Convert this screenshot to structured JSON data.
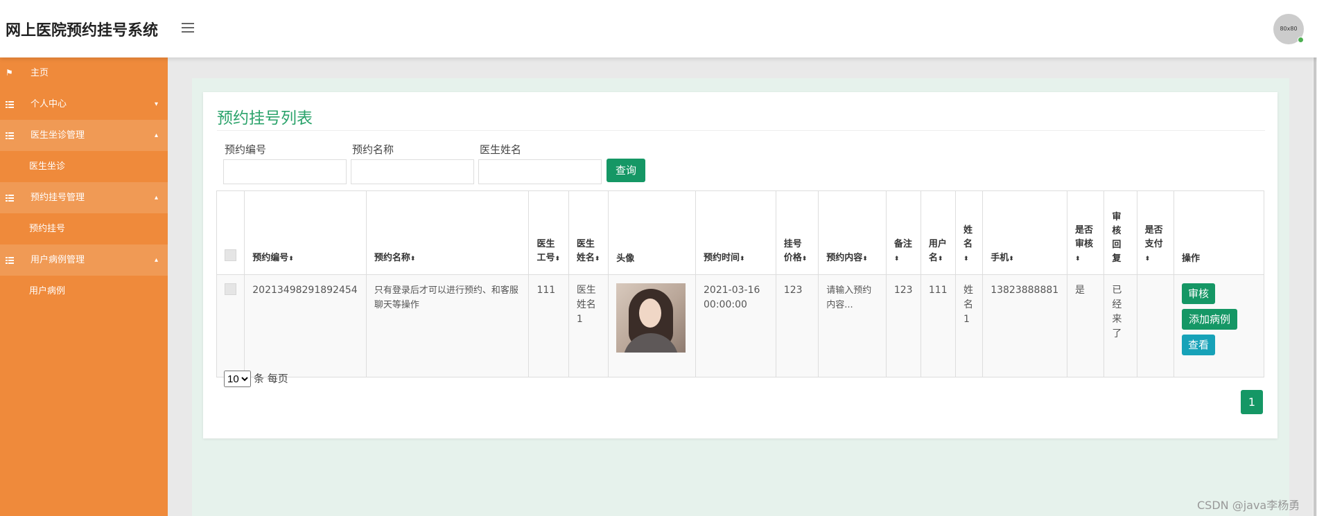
{
  "header": {
    "brand": "网上医院预约挂号系统",
    "avatar_text": "80x80"
  },
  "sidebar": {
    "items": [
      {
        "label": "主页",
        "icon": "flag-icon",
        "kind": "top"
      },
      {
        "label": "个人中心",
        "icon": "grid-icon",
        "kind": "group",
        "caret": "▾"
      },
      {
        "label": "医生坐诊管理",
        "icon": "grid-icon",
        "kind": "group-open",
        "caret": "▴"
      },
      {
        "label": "医生坐诊",
        "kind": "sub"
      },
      {
        "label": "预约挂号管理",
        "icon": "grid-icon",
        "kind": "group-open",
        "caret": "▴"
      },
      {
        "label": "预约挂号",
        "kind": "sub"
      },
      {
        "label": "用户病例管理",
        "icon": "grid-icon",
        "kind": "group-open",
        "caret": "▴"
      },
      {
        "label": "用户病例",
        "kind": "sub"
      }
    ]
  },
  "main": {
    "title": "预约挂号列表",
    "search": {
      "fields": [
        {
          "label": "预约编号",
          "value": ""
        },
        {
          "label": "预约名称",
          "value": ""
        },
        {
          "label": "医生姓名",
          "value": ""
        }
      ],
      "button": "查询"
    },
    "table": {
      "columns": [
        "预约编号",
        "预约名称",
        "医生工号",
        "医生姓名",
        "头像",
        "预约时间",
        "挂号价格",
        "预约内容",
        "备注",
        "用户名",
        "姓名",
        "手机",
        "是否审核",
        "审核回复",
        "是否支付",
        "操作"
      ],
      "rows": [
        {
          "booking_no": "20213498291892454",
          "booking_name": "只有登录后才可以进行预约、和客服聊天等操作",
          "doctor_id": "111",
          "doctor_name": "医生姓名1",
          "booking_time": "2021-03-16 00:00:00",
          "price": "123",
          "content": "请输入预约内容...",
          "remark": "123",
          "username": "111",
          "name": "姓名1",
          "phone": "13823888881",
          "reviewed": "是",
          "review_reply": "已经来了",
          "paid": "",
          "actions": {
            "review": "审核",
            "add_case": "添加病例",
            "view": "查看"
          }
        }
      ]
    },
    "pagination": {
      "page_size": "10",
      "page_size_suffix": "条 每页",
      "current_page": "1"
    }
  },
  "watermark": "CSDN @java李杨勇",
  "colors": {
    "sidebar": "#ef8a3b",
    "accent": "#159765",
    "title": "#2ba36b",
    "teal": "#17a2b8"
  }
}
